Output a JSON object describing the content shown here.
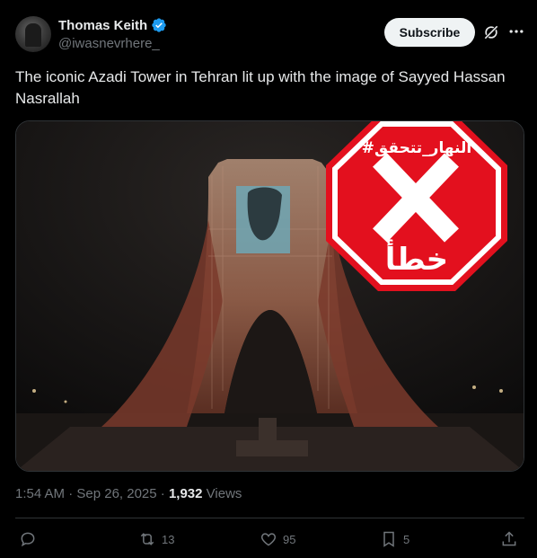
{
  "post": {
    "author": {
      "name": "Thomas Keith",
      "handle": "@iwasnevrhere_",
      "verified": true,
      "avatar_icon": "avatar"
    },
    "subscribe_label": "Subscribe",
    "text": "The iconic Azadi Tower in Tehran lit up with the image of Sayyed Hassan Nasrallah",
    "media": {
      "description_icon": "azadi-tower-photo",
      "stamp": {
        "hashtag": "#النهار_تتحقق",
        "verdict": "خطأ",
        "color": "#e3101e"
      }
    },
    "timestamp": "1:54 AM · Sep 26, 2025 · ",
    "views_count": "1,932",
    "views_label": " Views",
    "actions": {
      "reply_count": "",
      "repost_count": "13",
      "like_count": "95",
      "bookmark_count": "5"
    }
  },
  "colors": {
    "background": "#000000",
    "text_primary": "#e7e9ea",
    "text_secondary": "#71767b",
    "verified": "#1d9bf0",
    "border": "#2f3336"
  }
}
